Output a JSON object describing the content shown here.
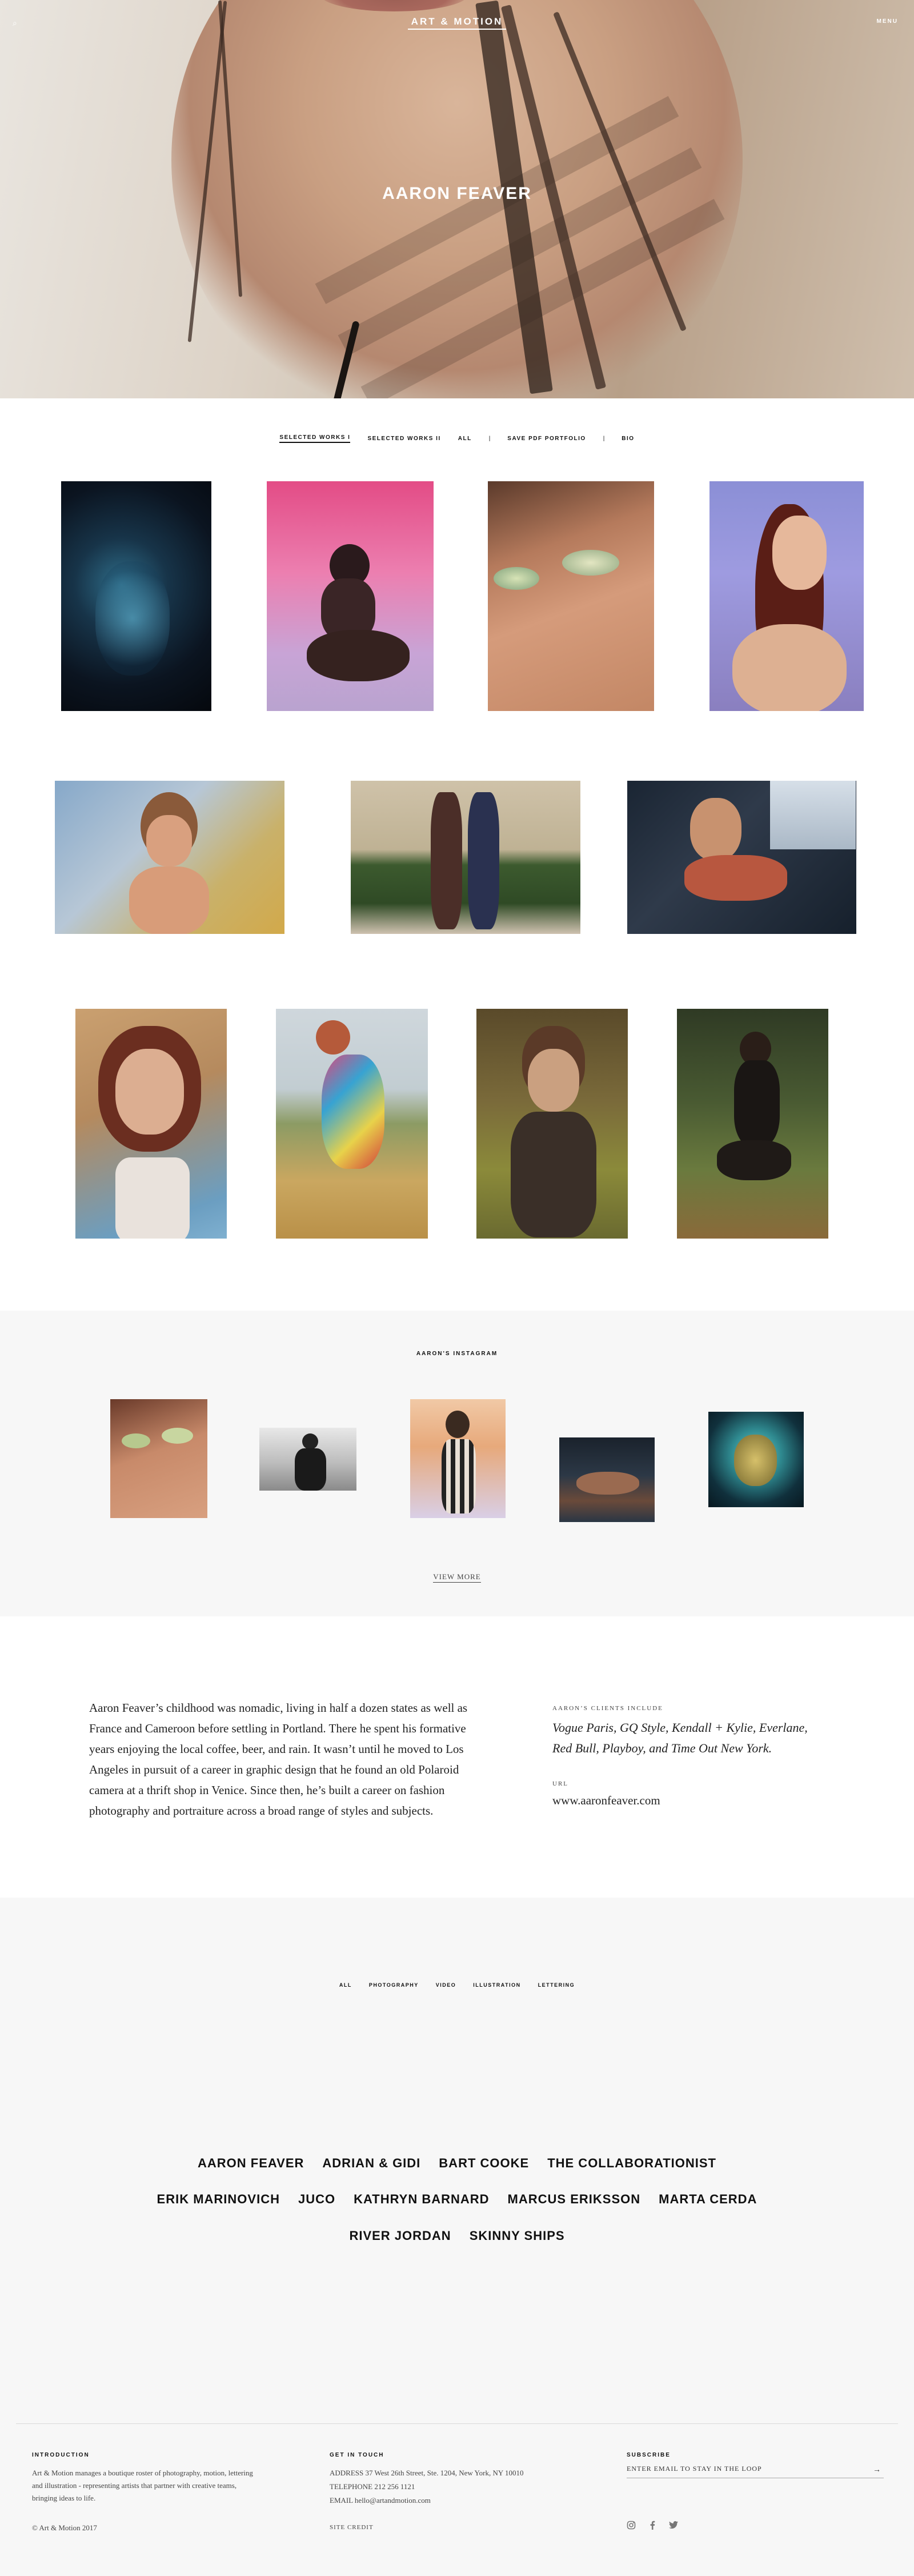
{
  "header": {
    "search_icon": "⌕",
    "logo": "ART & MOTION",
    "menu_label": "MENU"
  },
  "hero": {
    "title": "AARON FEAVER"
  },
  "work_nav": {
    "items": [
      "SELECTED WORKS I",
      "SELECTED WORKS II",
      "ALL",
      "SAVE PDF PORTFOLIO",
      "BIO"
    ],
    "separator": "|"
  },
  "instagram": {
    "title": "AARON'S INSTAGRAM",
    "view_more": "VIEW MORE"
  },
  "bio": {
    "text": "Aaron Feaver’s childhood was nomadic, living in half a dozen states as well as France and Cameroon before settling in Portland. There he spent his formative years enjoying the local coffee, beer, and rain. It wasn’t until he moved to Los Angeles in pursuit of a career in graphic design that he found an old Polaroid camera at a thrift shop in Venice. Since then, he’s built a career on fashion photography and portraiture across a broad range of styles and subjects.",
    "clients_label": "AARON’S CLIENTS INCLUDE",
    "clients_text": "Vogue Paris, GQ Style, Kendall + Kylie, Everlane, Red Bull, Playboy, and Time Out New York.",
    "url_label": "URL",
    "url_value": "www.aaronfeaver.com"
  },
  "categories": [
    "ALL",
    "PHOTOGRAPHY",
    "VIDEO",
    "ILLUSTRATION",
    "LETTERING"
  ],
  "artists": {
    "row1": [
      "AARON FEAVER",
      "ADRIAN & GIDI",
      "BART COOKE",
      "THE COLLABORATIONIST"
    ],
    "row2": [
      "ERIK MARINOVICH",
      "JUCO",
      "KATHRYN BARNARD",
      "MARCUS ERIKSSON",
      "MARTA CERDA"
    ],
    "row3": [
      "RIVER JORDAN",
      "SKINNY SHIPS"
    ]
  },
  "footer": {
    "intro_head": "INTRODUCTION",
    "intro_text": "Art & Motion manages a boutique roster of photography, motion, lettering and illustration - representing artists that partner with creative teams, bringing ideas to life.",
    "copyright": "© Art & Motion 2017",
    "contact_head": "GET IN TOUCH",
    "address": "ADDRESS  37 West 26th Street, Ste. 1204, New York, NY 10010",
    "telephone": "TELEPHONE  212 256 1121",
    "email": "EMAIL  hello@artandmotion.com",
    "site_credit": "SITE CREDIT",
    "subscribe_head": "SUBSCRIBE",
    "subscribe_placeholder": "ENTER EMAIL TO STAY IN THE LOOP",
    "subscribe_arrow": "→",
    "social_icons": [
      "instagram-icon",
      "facebook-icon",
      "twitter-icon"
    ]
  }
}
